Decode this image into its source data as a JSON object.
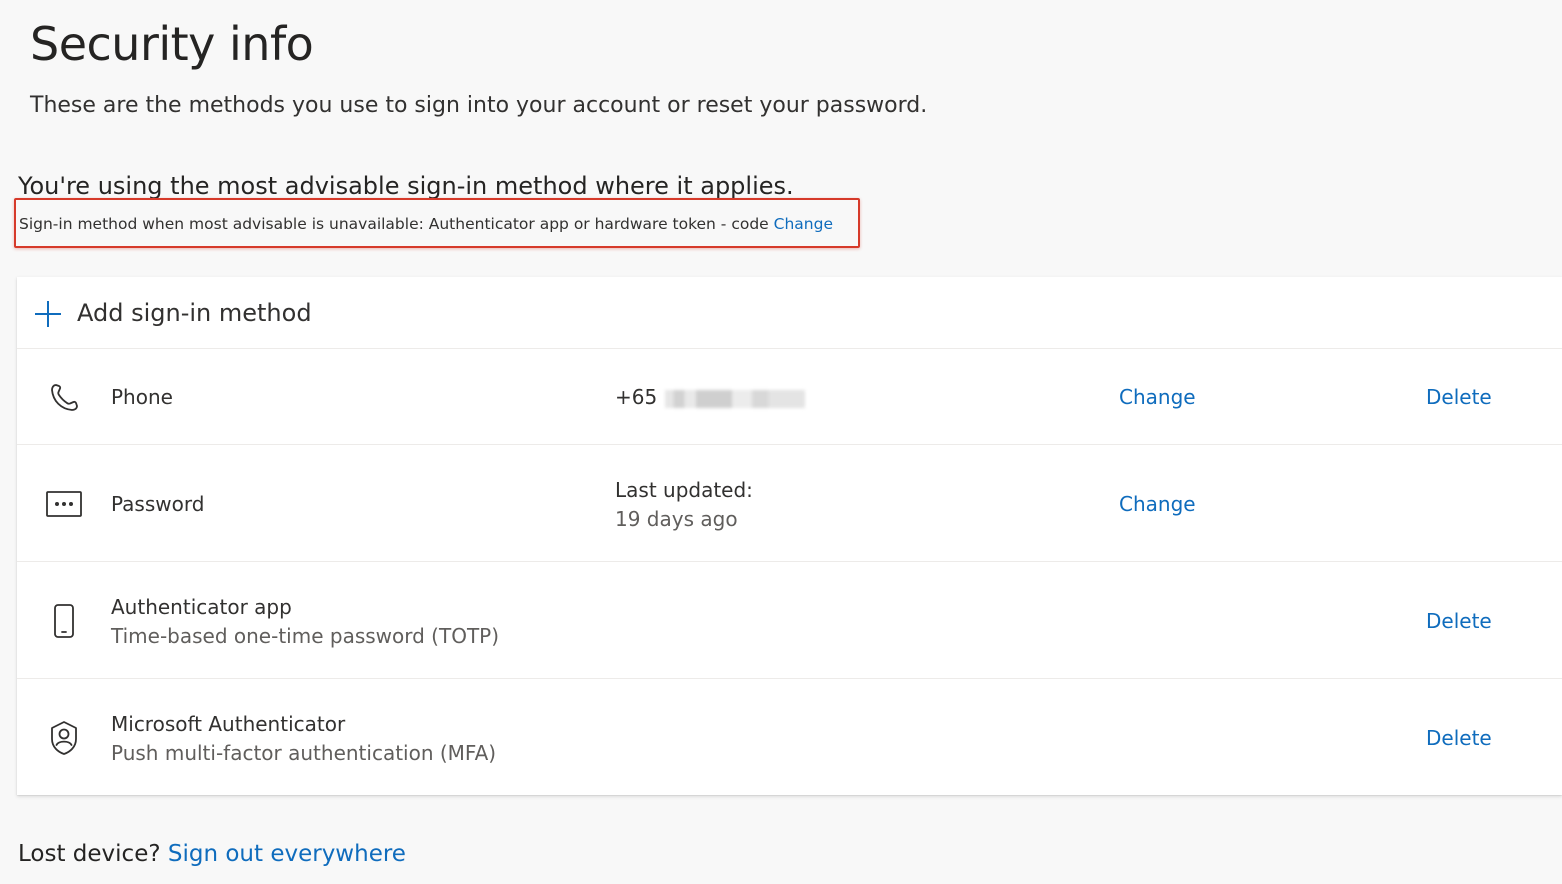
{
  "page": {
    "title": "Security info",
    "subtitle": "These are the methods you use to sign into your account or reset your password."
  },
  "advisory": {
    "headline": "You're using the most advisable sign-in method where it applies.",
    "fallback_text": "Sign-in method when most advisable is unavailable: Authenticator app or hardware token - code",
    "fallback_link": "Change",
    "highlight_color": "#d63a2a"
  },
  "methods_card": {
    "add_label": "Add sign-in method",
    "add_icon": "plus-icon",
    "items": [
      {
        "icon": "phone-icon",
        "name": "Phone",
        "detail": "+65",
        "detail_redacted": true,
        "change_label": "Change",
        "delete_label": "Delete"
      },
      {
        "icon": "password-icon",
        "name": "Password",
        "detail": "Last updated:",
        "detail_sub": "19 days ago",
        "change_label": "Change"
      },
      {
        "icon": "mobile-device-icon",
        "name": "Authenticator app",
        "sub": "Time-based one-time password (TOTP)",
        "delete_label": "Delete"
      },
      {
        "icon": "microsoft-authenticator-icon",
        "name": "Microsoft Authenticator",
        "sub": "Push multi-factor authentication (MFA)",
        "delete_label": "Delete"
      }
    ]
  },
  "footer": {
    "lost_label": "Lost device?",
    "signout_link": "Sign out everywhere"
  },
  "colors": {
    "accent": "#0f6cbd",
    "background": "#f8f8f8",
    "card": "#ffffff",
    "text": "#323130",
    "subtext": "#605e5c"
  }
}
